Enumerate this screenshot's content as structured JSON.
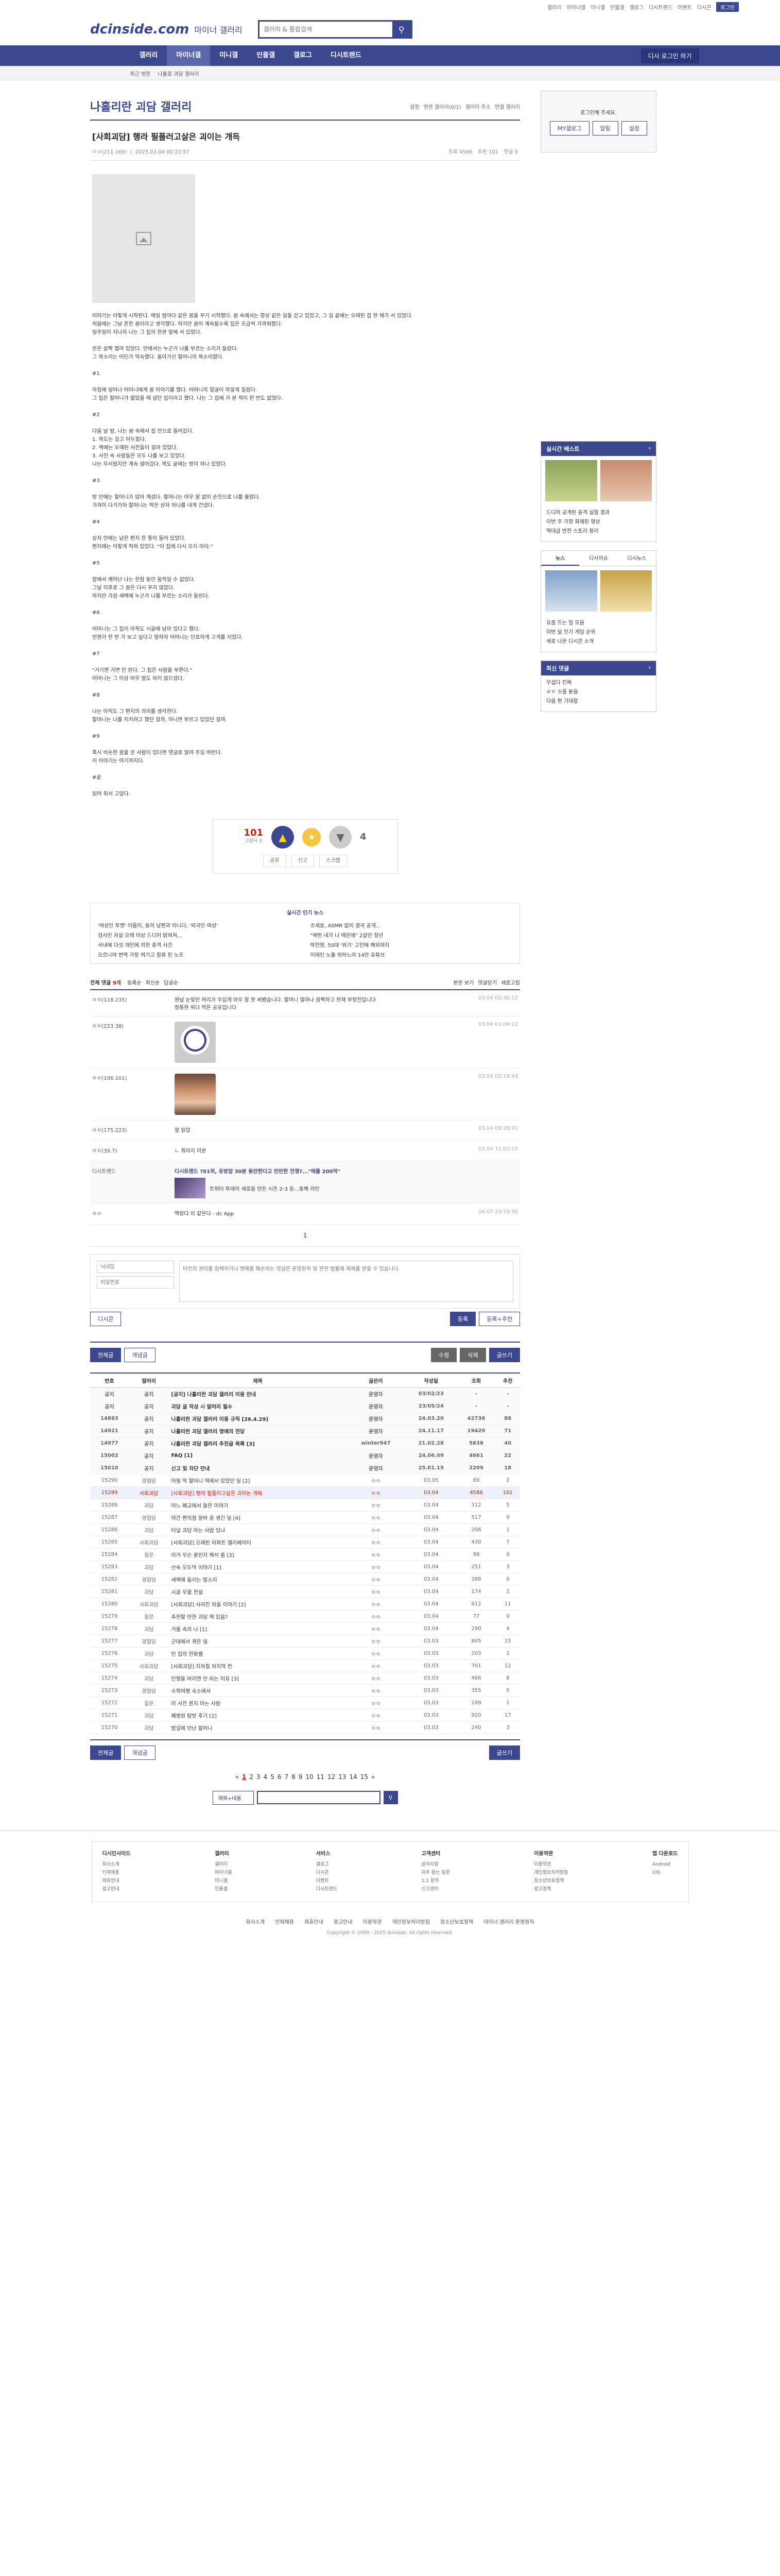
{
  "util": [
    "갤러리",
    "마이너갤",
    "미니갤",
    "인물갤",
    "갤로그",
    "디시트렌드",
    "이벤트",
    "디시콘",
    "로그인"
  ],
  "header": {
    "logo": "dcinside.com",
    "logo_sub": "마이너 갤러리",
    "search_placeholder": "갤러리 & 통합검색"
  },
  "gnb": {
    "items": [
      "갤러리",
      "마이너갤",
      "미니갤",
      "인물갤",
      "갤로그",
      "디시트렌드"
    ],
    "right": "디시 로그인 하기"
  },
  "subbar": [
    "최근 방문",
    "나홀로 괴담 갤러리"
  ],
  "gall": {
    "title": "나홀리란 괴담 갤러리",
    "tools": [
      "설정",
      "연관 갤러리(0/1)",
      "갤러리 주소",
      "연결 갤러리"
    ]
  },
  "post": {
    "subject": "[사회괴담] 행라 필플러고살은 괴이는 개득",
    "writer": "ㅇㅇ(211.169)",
    "date": "2025.03.04 00:22:57",
    "views": "조회 4586",
    "reco": "추천 101",
    "comments": "댓글 9",
    "paragraphs": [
      "이야기는 이렇게 시작된다. 매일 밤마다 같은 꿈을 꾸기 시작했다. 꿈 속에서는 항상 같은 길을 걷고 있었고, 그 길 끝에는 오래된 집 한 채가 서 있었다.\n처음에는 그냥 흔한 꿈이라고 생각했다. 하지만 꿈이 계속될수록 집은 조금씩 가까워졌다.\n일주일이 지나자 나는 그 집의 현관 앞에 서 있었다.",
      "문은 살짝 열려 있었다. 안에서는 누군가 나를 부르는 소리가 들렸다.\n그 목소리는 어딘가 익숙했다. 돌아가신 할머니의 목소리였다.",
      "#1\n\n아침에 일어나 어머니에게 꿈 이야기를 했다. 어머니의 얼굴이 하얗게 질렸다.\n그 집은 할머니가 젊었을 때 살던 집이라고 했다. 나는 그 집에 가 본 적이 한 번도 없었다.",
      "#2\n\n다음 날 밤, 나는 꿈 속에서 집 안으로 들어갔다.\n1. 복도는 길고 어두웠다.\n2. 벽에는 오래된 사진들이 걸려 있었다.\n3. 사진 속 사람들은 모두 나를 보고 있었다.\n나는 무서웠지만 계속 걸어갔다. 복도 끝에는 방이 하나 있었다.",
      "#3\n\n방 안에는 할머니가 앉아 계셨다. 할머니는 아무 말 없이 손짓으로 나를 불렀다.\n가까이 다가가자 할머니는 작은 상자 하나를 내게 건넸다.",
      "#4\n\n상자 안에는 낡은 편지 한 통이 들어 있었다.\n편지에는 이렇게 적혀 있었다. \"이 집에 다시 오지 마라.\"",
      "#5\n\n잠에서 깨어난 나는 한참 동안 움직일 수 없었다.\n그날 이후로 그 꿈은 다시 꾸지 않았다.\n하지만 가끔 새벽에 누군가 나를 부르는 소리가 들린다.",
      "#6\n\n어머니는 그 집이 아직도 시골에 남아 있다고 했다.\n언젠가 한 번 가 보고 싶다고 말하자 어머니는 단호하게 고개를 저었다.",
      "#7\n\n\"거기엔 가면 안 된다. 그 집은 사람을 부른다.\"\n어머니는 그 이상 아무 말도 하지 않으셨다.",
      "#8\n\n나는 아직도 그 편지의 의미를 생각한다.\n할머니는 나를 지키려고 했던 걸까, 아니면 부르고 있었던 걸까.",
      "#9\n\n혹시 비슷한 꿈을 꾼 사람이 있다면 댓글로 알려 주길 바란다.\n이 이야기는 여기까지다.",
      "#끝\n\n읽어 줘서 고맙다."
    ],
    "reco_up": "101",
    "reco_fix": "고정닉 0",
    "reco_down": "4",
    "tools": [
      "공유",
      "신고",
      "스크랩"
    ]
  },
  "hot": {
    "title": "실시간 인기 뉴스",
    "items": [
      "'여성인 투명' 이름이, 동의 남편과 아니다, '외국인 여성'",
      "조세호, ASMR 없이 결국 공개...",
      "검사인 자살 오래 이상 드디어 밝혀져...",
      "\"매번 내가 나 때문에\" 2살만 청년",
      "국내에 다섯 개인에 의한 충격 사건",
      "박진영, 50대 '위기' 고민에 해외까지",
      "오르니야 번역 가장 여기고 합류 된 노조",
      "이태인 노출 위하느라 14만 유튜브"
    ]
  },
  "comments": {
    "label": "전체 댓글",
    "count": "9개",
    "sort": [
      "등록순",
      "최신순",
      "답글순"
    ],
    "tools": [
      "본문 보기",
      "댓글닫기",
      "새로고침"
    ],
    "list": [
      {
        "nick": "ㅇㅇ(118.235)",
        "text": "뭔날 눈빛만 처리가 무섭게 아우 잘 못 써봤습니다. 할머니 얼마나 끔찍하고 현재 부정진입니다\n정통한 위다 먹은 공포입니다",
        "date": "03.04 00:36:12",
        "kind": "text"
      },
      {
        "nick": "ㅇㅇ(223.38)",
        "text": "",
        "date": "03.04 01:04:22",
        "kind": "logo"
      },
      {
        "nick": "ㅇㅇ(106.101)",
        "text": "",
        "date": "03.04 02:18:49",
        "kind": "face"
      },
      {
        "nick": "ㅇㅇ(175.223)",
        "text": "잘 읽었",
        "date": "03.04 09:26:41",
        "kind": "text"
      },
      {
        "nick": "ㅇㅇ(39.7)",
        "text": "ㄴ 뭐라지 이분",
        "date": "03.04 11:02:15",
        "kind": "text"
      }
    ],
    "ad": {
      "label": "디시트렌드",
      "title": "디시트렌드 ?01위, 유방암 30분 동안한다고 만만한 전쟁?...\"애플 200억\"",
      "sub": "트위터 투데이 새로움 만든 시즌 2-3 등...동해 라인"
    },
    "last": {
      "nick": "ㅇㅇ",
      "text": "맥랑다 이 같은다 - dc App",
      "date": "04.07 23:18:36"
    },
    "page": "1",
    "write": {
      "nick_ph": "닉네임",
      "pw_ph": "비밀번호",
      "text_ph": "타인의 권리를 침해하거나 명예를 훼손하는 댓글은 운영원칙 및 관련 법률에 제재를 받을 수 있습니다.",
      "dccon": "디시콘",
      "submit": "등록",
      "submit2": "등록+추천"
    }
  },
  "list_tools": {
    "left": [
      "전체글",
      "개념글"
    ],
    "right": [
      "수정",
      "삭제",
      "글쓰기"
    ]
  },
  "list": {
    "headers": [
      "번호",
      "말머리",
      "제목",
      "글쓴이",
      "작성일",
      "조회",
      "추천"
    ],
    "rows": [
      [
        "공지",
        "공지",
        "[공지] 나홀리란 괴담 갤러리 이용 안내",
        "운영자",
        "03/02/23",
        "-",
        "-"
      ],
      [
        "공지",
        "공지",
        "괴담 글 작성 시 말머리 필수",
        "운영자",
        "23/05/24",
        "-",
        "-"
      ],
      [
        "14863",
        "공지",
        "나홀리란 괴담 갤러리 이용 규칙 [26.4.29]",
        "운영자",
        "24.03.20",
        "42736",
        "88"
      ],
      [
        "14921",
        "공지",
        "나홀리란 괴담 갤러리 명예의 전당",
        "운영자",
        "24.11.17",
        "19429",
        "71"
      ],
      [
        "14977",
        "공지",
        "나홀리란 괴담 갤러리 추천글 목록 [3]",
        "winter947",
        "21.02.28",
        "5838",
        "40"
      ],
      [
        "15002",
        "공지",
        "FAQ [1]",
        "운영자",
        "24.06.09",
        "4661",
        "22"
      ],
      [
        "15010",
        "공지",
        "신고 및 차단 안내",
        "운영자",
        "25.01.15",
        "2209",
        "18"
      ],
      [
        "15290",
        "경험담",
        "어릴 적 할머니 댁에서 있었던 일 [2]",
        "ㅇㅇ",
        "03.05",
        "89",
        "2"
      ],
      [
        "15289",
        "사회괴담",
        "[사회괴담] 행라 필플러고살은 괴이는 개득",
        "ㅇㅇ",
        "03.04",
        "4586",
        "101"
      ],
      [
        "15288",
        "괴담",
        "어느 폐교에서 들은 이야기",
        "ㅇㅇ",
        "03.04",
        "312",
        "5"
      ],
      [
        "15287",
        "경험담",
        "야간 편의점 알바 중 생긴 일 [4]",
        "ㅇㅇ",
        "03.04",
        "517",
        "9"
      ],
      [
        "15286",
        "괴담",
        "터널 괴담 아는 사람 있냐",
        "ㅇㅇ",
        "03.04",
        "206",
        "1"
      ],
      [
        "15285",
        "사회괴담",
        "[사회괴담] 오래된 아파트 엘리베이터",
        "ㅇㅇ",
        "03.04",
        "430",
        "7"
      ],
      [
        "15284",
        "질문",
        "이거 무슨 꿈인지 해석 좀 [3]",
        "ㅇㅇ",
        "03.04",
        "98",
        "0"
      ],
      [
        "15283",
        "괴담",
        "산속 오두막 이야기 [1]",
        "ㅇㅇ",
        "03.04",
        "251",
        "3"
      ],
      [
        "15282",
        "경험담",
        "새벽에 들리는 발소리",
        "ㅇㅇ",
        "03.04",
        "388",
        "6"
      ],
      [
        "15281",
        "괴담",
        "시골 우물 전설",
        "ㅇㅇ",
        "03.04",
        "174",
        "2"
      ],
      [
        "15280",
        "사회괴담",
        "[사회괴담] 사라진 마을 이야기 [2]",
        "ㅇㅇ",
        "03.04",
        "612",
        "11"
      ],
      [
        "15279",
        "질문",
        "추천할 만한 괴담 책 있음?",
        "ㅇㅇ",
        "03.04",
        "77",
        "0"
      ],
      [
        "15278",
        "괴담",
        "거울 속의 나 [1]",
        "ㅇㅇ",
        "03.04",
        "290",
        "4"
      ],
      [
        "15277",
        "경험담",
        "군대에서 겪은 일",
        "ㅇㅇ",
        "03.03",
        "845",
        "15"
      ],
      [
        "15276",
        "괴담",
        "빈 집의 전화벨",
        "ㅇㅇ",
        "03.03",
        "203",
        "2"
      ],
      [
        "15275",
        "사회괴담",
        "[사회괴담] 지하철 마지막 칸",
        "ㅇㅇ",
        "03.03",
        "701",
        "12"
      ],
      [
        "15274",
        "괴담",
        "인형을 버리면 안 되는 이유 [3]",
        "ㅇㅇ",
        "03.03",
        "466",
        "8"
      ],
      [
        "15273",
        "경험담",
        "수학여행 숙소에서",
        "ㅇㅇ",
        "03.03",
        "355",
        "5"
      ],
      [
        "15272",
        "질문",
        "이 사진 뭔지 아는 사람",
        "ㅇㅇ",
        "03.03",
        "189",
        "1"
      ],
      [
        "15271",
        "괴담",
        "폐병원 탐방 후기 [2]",
        "ㅇㅇ",
        "03.03",
        "920",
        "17"
      ],
      [
        "15270",
        "괴담",
        "밤길에 만난 할머니",
        "ㅇㅇ",
        "03.03",
        "240",
        "3"
      ]
    ]
  },
  "paging": [
    "1",
    "2",
    "3",
    "4",
    "5",
    "6",
    "7",
    "8",
    "9",
    "10",
    "11",
    "12",
    "13",
    "14",
    "15"
  ],
  "bottom_search": {
    "select": "제목+내용"
  },
  "side": {
    "login": "로그인해 주세요.",
    "login_btns": [
      "MY갤로그",
      "알림",
      "설정"
    ],
    "news_title": "실시간 베스트",
    "news_list": [
      "드디어 공개된 충격 실험 결과",
      "이번 주 가장 화제된 영상",
      "역대급 반전 스토리 정리"
    ],
    "tabs": [
      "뉴스",
      "디시이슈",
      "디시뉴스"
    ],
    "trend_title": "디시트렌드",
    "trend_list": [
      "요즘 뜨는 밈 모음",
      "이번 달 인기 게임 순위",
      "새로 나온 디시콘 소개"
    ],
    "cmt_title": "최신 댓글",
    "cmt_list": [
      "무섭다 진짜",
      "ㄹㅇ 소름 돋음",
      "다음 편 기대함"
    ]
  },
  "footer": {
    "cols": [
      {
        "title": "디시인사이드",
        "items": [
          "회사소개",
          "인재채용",
          "제휴안내",
          "광고안내"
        ]
      },
      {
        "title": "갤러리",
        "items": [
          "갤러리",
          "마이너갤",
          "미니갤",
          "인물갤"
        ]
      },
      {
        "title": "서비스",
        "items": [
          "갤로그",
          "디시콘",
          "이벤트",
          "디시트렌드"
        ]
      },
      {
        "title": "고객센터",
        "items": [
          "공지사항",
          "자주 묻는 질문",
          "1:1 문의",
          "신고센터"
        ]
      },
      {
        "title": "이용약관",
        "items": [
          "이용약관",
          "개인정보처리방침",
          "청소년보호정책",
          "광고정책"
        ]
      },
      {
        "title": "앱 다운로드",
        "items": [
          "Android",
          "iOS"
        ]
      }
    ],
    "links": [
      "회사소개",
      "인재채용",
      "제휴안내",
      "광고안내",
      "이용약관",
      "개인정보처리방침",
      "청소년보호정책",
      "마이너 갤러리 운영원칙"
    ],
    "copy": "Copyright © 1999 - 2025 dcinside. All rights reserved."
  },
  "colors": {
    "brand": "#3b4890",
    "accent": "#d31900"
  }
}
